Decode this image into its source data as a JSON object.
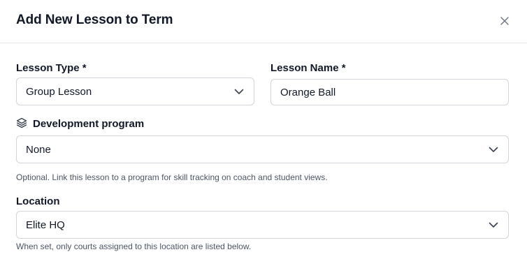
{
  "dialog": {
    "title": "Add New Lesson to Term",
    "close_icon": "close-icon"
  },
  "form": {
    "lesson_type": {
      "label": "Lesson Type *",
      "value": "Group Lesson"
    },
    "lesson_name": {
      "label": "Lesson Name *",
      "value": "Orange Ball"
    },
    "development_program": {
      "label": "Development program",
      "icon": "layers-icon",
      "value": "None",
      "hint": "Optional. Link this lesson to a program for skill tracking on coach and student views."
    },
    "location": {
      "label": "Location",
      "value": "Elite HQ",
      "hint": "When set, only courts assigned to this location are listed below."
    }
  },
  "colors": {
    "border": "#d1d5db",
    "text": "#111827",
    "muted": "#4b5563"
  }
}
